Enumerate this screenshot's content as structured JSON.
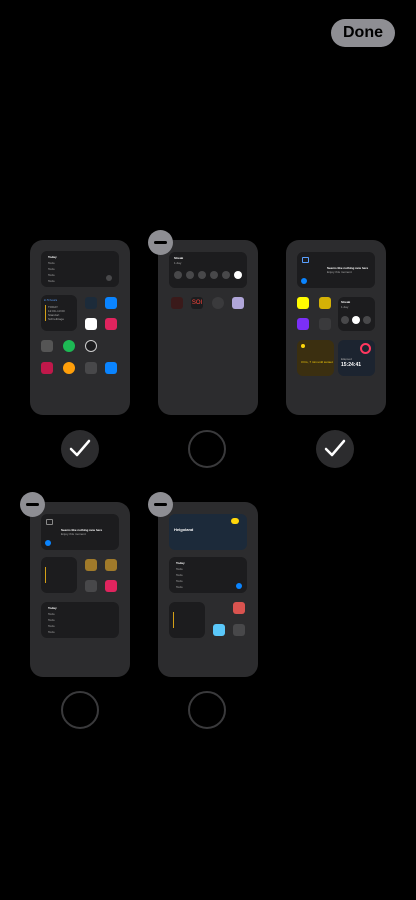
{
  "header": {
    "done_label": "Done"
  },
  "pages": [
    {
      "id": 1,
      "selected": true,
      "todo_title": "Today",
      "todo_items": [
        "Todo",
        "Todo",
        "Todo",
        "Todo"
      ],
      "calendar_lines": [
        "TODAY",
        "12:00–13:00",
        "Standort",
        "Schreibtage"
      ],
      "calendar_header": "in 5 hours"
    },
    {
      "id": 2,
      "selected": false,
      "streak_title": "Streak",
      "streak_sub": "1 day",
      "text_widget": "SOI"
    },
    {
      "id": 3,
      "selected": true,
      "notif_title": "Seems like nothing new here",
      "notif_sub": "Enjoy this moment",
      "streak_title": "Streak",
      "streak_sub": "1 day",
      "sunset_text": "3 hrs, 7 min until sunset",
      "timer_label": "Elapsed",
      "timer_value": "15:24:41"
    },
    {
      "id": 4,
      "selected": false,
      "notif_title": "Seems like nothing new here",
      "notif_sub": "Enjoy this moment",
      "todo_title": "Today",
      "todo_items": [
        "Todo",
        "Todo",
        "Todo",
        "Todo"
      ]
    },
    {
      "id": 5,
      "selected": false,
      "weather_place": "Helgoland",
      "todo_title": "Today",
      "todo_items": [
        "Todo",
        "Todo",
        "Todo",
        "Todo"
      ]
    }
  ]
}
